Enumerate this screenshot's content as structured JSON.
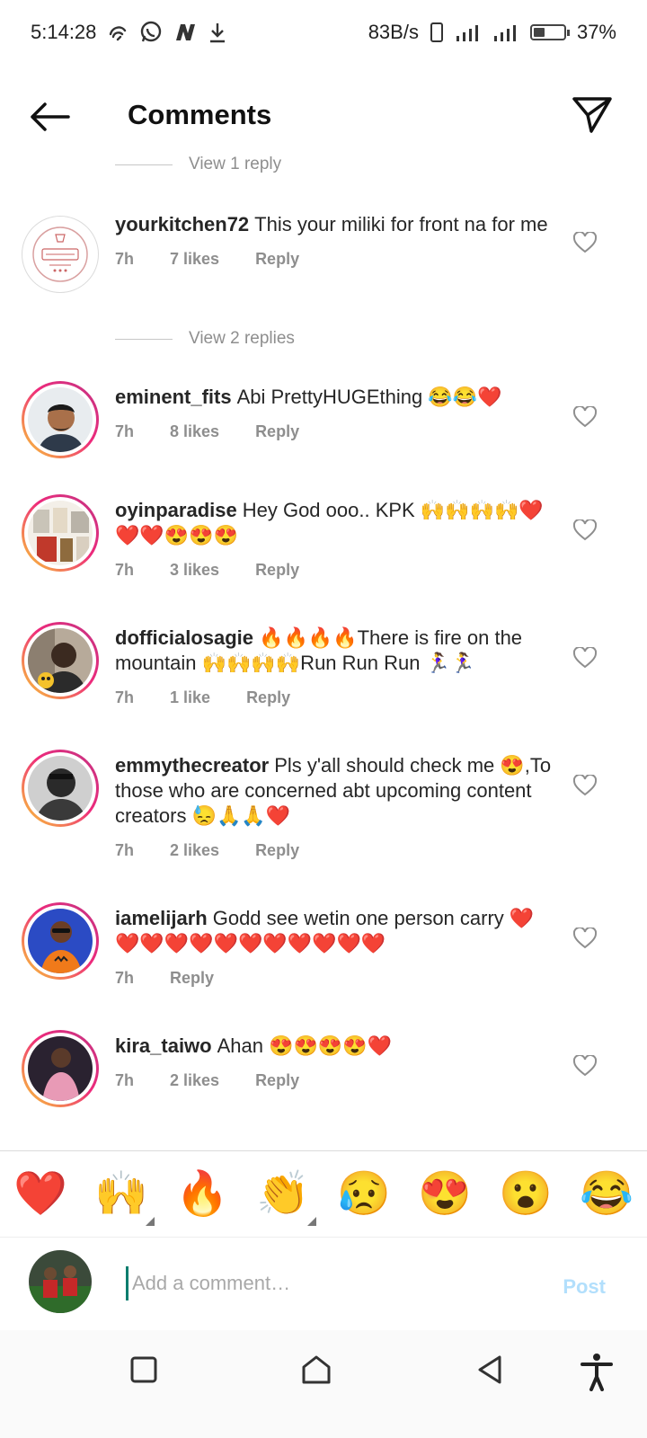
{
  "status_bar": {
    "time": "5:14:28",
    "left_icons": [
      "hotspot-icon",
      "whatsapp-icon",
      "n-app-icon",
      "download-icon"
    ],
    "net_speed": "83B/s",
    "right_icons": [
      "vibrate-icon",
      "signal-icon",
      "signal-icon"
    ],
    "battery_level": 0.37,
    "battery_percent": "37%"
  },
  "header": {
    "title": "Comments",
    "back_icon": "arrow-left-icon",
    "send_icon": "paper-plane-icon"
  },
  "top_view_replies": "View 1 reply",
  "comments": [
    {
      "username": "yourkitchen72",
      "text": "This your miliki for front na for me",
      "time": "7h",
      "likes": "7 likes",
      "reply": "Reply",
      "avatar": "kitchen-logo",
      "view_replies": "View 2 replies"
    },
    {
      "username": "eminent_fits",
      "text": "Abi PrettyHUGEthing 😂😂❤️",
      "time": "7h",
      "likes": "8 likes",
      "reply": "Reply",
      "avatar": "cartoon-man"
    },
    {
      "username": "oyinparadise",
      "text": "Hey God ooo.. KPK 🙌🙌🙌🙌❤️❤️❤️😍😍😍",
      "time": "7h",
      "likes": "3 likes",
      "reply": "Reply",
      "avatar": "products-photo"
    },
    {
      "username": "dofficialosagie",
      "text": "🔥🔥🔥🔥There is fire on the mountain 🙌🙌🙌🙌Run Run Run 🏃‍♀️🏃‍♀️",
      "time": "7h",
      "likes": "1 like",
      "reply": "Reply",
      "avatar": "man-photo"
    },
    {
      "username": "emmythecreator",
      "text": "Pls y'all should check me 😍,To those who are concerned abt upcoming content creators 😓🙏🙏❤️",
      "time": "7h",
      "likes": "2 likes",
      "reply": "Reply",
      "avatar": "bw-portrait"
    },
    {
      "username": "iamelijarh",
      "text": "Godd see wetin one person carry ❤️❤️❤️❤️❤️❤️❤️❤️❤️❤️❤️❤️",
      "time": "7h",
      "likes": "",
      "reply": "Reply",
      "avatar": "cartoon-pumpkin"
    },
    {
      "username": "kira_taiwo",
      "text": "Ahan 😍😍😍😍❤️",
      "time": "7h",
      "likes": "2 likes",
      "reply": "Reply",
      "avatar": "woman-photo"
    }
  ],
  "reactions": [
    "❤️",
    "🙌",
    "🔥",
    "👏",
    "😥",
    "😍",
    "😮",
    "😂"
  ],
  "composer": {
    "placeholder": "Add a comment…",
    "post_label": "Post"
  },
  "nav": {
    "recents_icon": "square-icon",
    "home_icon": "home-icon",
    "back_icon": "triangle-back-icon",
    "accessibility_icon": "accessibility-icon"
  }
}
